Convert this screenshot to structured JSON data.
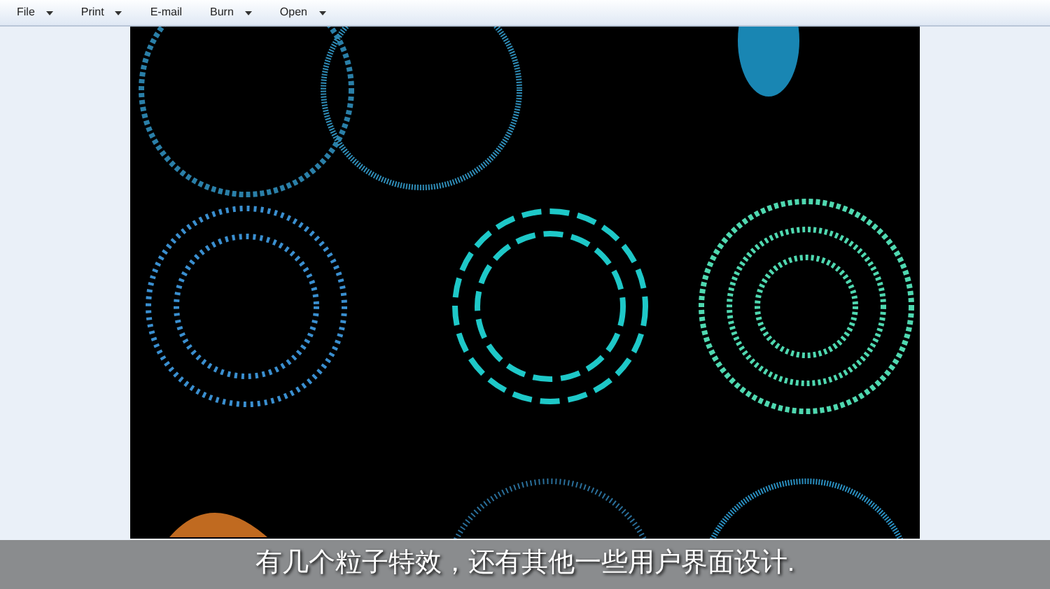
{
  "menu": [
    {
      "label": "File",
      "dropdown": true
    },
    {
      "label": "Print",
      "dropdown": true
    },
    {
      "label": "E-mail",
      "dropdown": false
    },
    {
      "label": "Burn",
      "dropdown": true
    },
    {
      "label": "Open",
      "dropdown": true
    }
  ],
  "subtitle": "有几个粒子特效，还有其他一些用户界面设计."
}
